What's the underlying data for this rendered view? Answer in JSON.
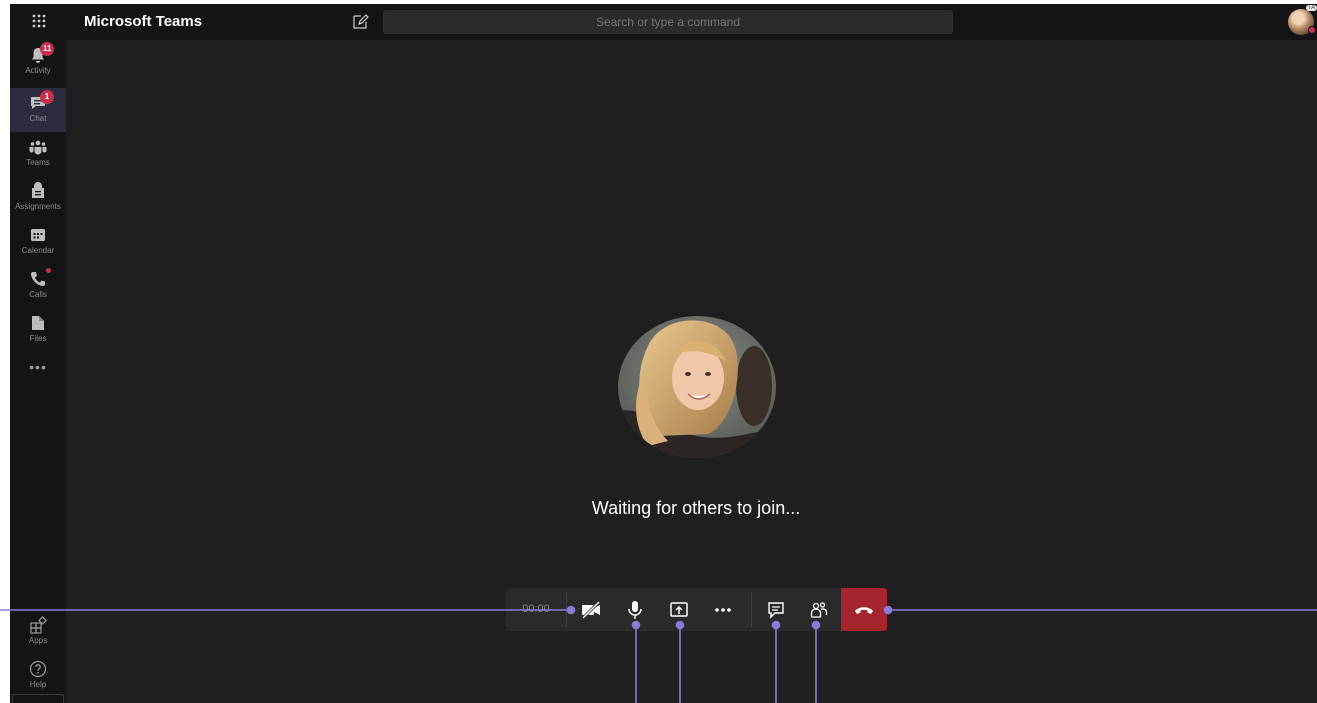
{
  "app": {
    "title": "Microsoft Teams"
  },
  "search": {
    "placeholder": "Search or type a command"
  },
  "user": {
    "initials": "TA"
  },
  "rail": {
    "items": [
      {
        "label": "Activity",
        "badge": "11",
        "icon": "bell-icon"
      },
      {
        "label": "Chat",
        "badge": "1",
        "icon": "chat-icon"
      },
      {
        "label": "Teams",
        "icon": "teams-icon"
      },
      {
        "label": "Assignments",
        "icon": "assignments-icon"
      },
      {
        "label": "Calendar",
        "icon": "calendar-icon"
      },
      {
        "label": "Calls",
        "icon": "phone-icon"
      },
      {
        "label": "Files",
        "icon": "files-icon"
      }
    ],
    "more": "•••",
    "bottom": [
      {
        "label": "Apps",
        "icon": "apps-icon"
      },
      {
        "label": "Help",
        "icon": "help-icon"
      }
    ]
  },
  "call": {
    "status": "Waiting for others to join...",
    "timer": "00:00",
    "more_label": "•••"
  },
  "colors": {
    "background": "#1f1f1f",
    "rail": "#141414",
    "badge": "#c4314b",
    "hangup": "#a4262c",
    "annotation": "#8b7bd8",
    "active_item": "#2d2c3e"
  }
}
